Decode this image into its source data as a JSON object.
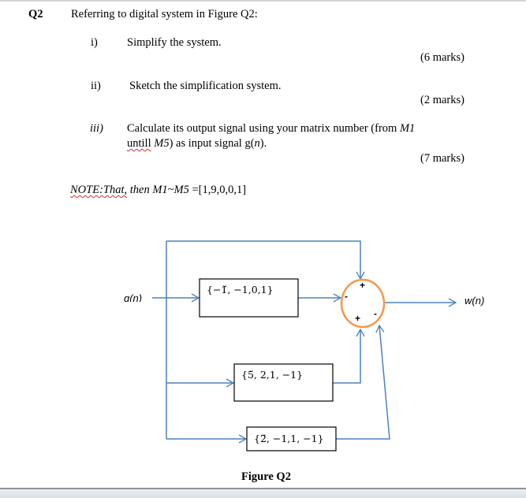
{
  "question": {
    "number": "Q2",
    "intro": "Referring to digital system in Figure Q2:",
    "parts": [
      {
        "label": "i)",
        "text": "Simplify the system.",
        "marks": "(6 marks)"
      },
      {
        "label": "ii)",
        "text": "Sketch the simplification  system.",
        "marks": "(2 marks)"
      },
      {
        "label": "iii)",
        "text_line1_a": "Calculate its output signal using your matrix number (from ",
        "text_line1_b": "M1",
        "text_line2_a": "untill",
        "text_line2_b": " M5",
        "text_line2_c": ") as input signal  g(",
        "text_line2_d": "n",
        "text_line2_e": ").",
        "marks": "(7 marks)"
      }
    ],
    "note_a": "NOTE:That,",
    "note_b": " then M1~M5 ",
    "note_c": "=[1,9,0,0,1]"
  },
  "figure": {
    "input_label": "g(n)",
    "output_label": "w(n)",
    "blocks": [
      {
        "label": "{−1̆, −1,0,1}"
      },
      {
        "label": "{5̆, 2,1, −1}"
      },
      {
        "label": "{2̆, −1,1, −1}"
      }
    ],
    "summer_signs": {
      "top": "+",
      "left": "-",
      "bottom_left": "+",
      "bottom_right": "-"
    },
    "caption": "Figure Q2",
    "colors": {
      "line": "#4f81bd",
      "summer": "#f79646",
      "block_border": "#000000"
    }
  }
}
